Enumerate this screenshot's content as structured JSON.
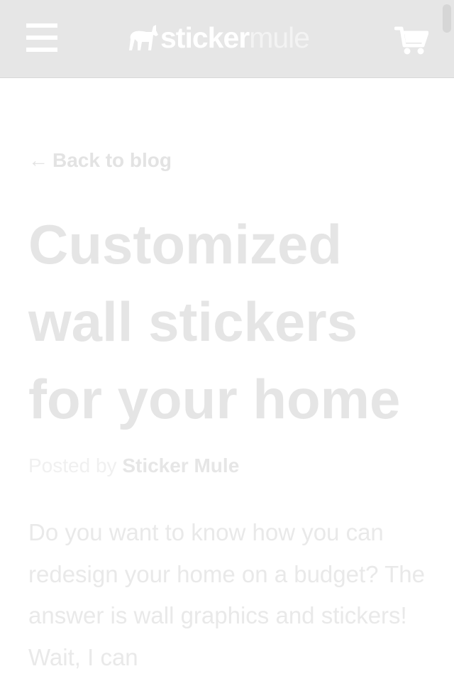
{
  "header": {
    "menu_icon": "hamburger-menu-icon",
    "logo": {
      "part1": "sticker",
      "part2": "mule",
      "icon": "mule-logo-icon"
    },
    "cart_icon": "shopping-cart-icon",
    "background": "#e6e6e6"
  },
  "article": {
    "back_arrow": "←",
    "back_label": "Back to blog",
    "title": "Customized wall stickers for your home",
    "byline_prefix": "Posted by",
    "author": "Sticker Mule",
    "body": "Do you want to know how you can redesign your home on a budget? The answer is wall graphics and stickers! Wait, I can"
  }
}
